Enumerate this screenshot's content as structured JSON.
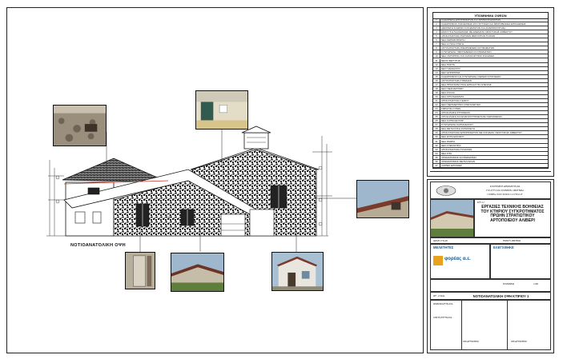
{
  "drawing": {
    "view_label": "ΝΟΤΙΟΑΝΑΤΟΛΙΚΗ ΟΨΗ"
  },
  "legend": {
    "title": "ΥΠΟΜΝΗΜΑ ΟΨΕΩΝ",
    "items": [
      {
        "n": "1",
        "text": "ΚΑΘΑΙΡΕΣΗ ΕΠΙΧΡΙΣΜΑΤΩΝ ΚΑΙ ΑΡΜΟΛΟΓΗΜΑΤΩΝ"
      },
      {
        "n": "2",
        "text": "ΚΑΘΑΡΙΣΜΟΣ ΛΙΘΟΔΟΜΗΣ ΑΠΟ ΦΥΤΙΚΕΣ ΚΑΙ ΜΙΚΡΟΒΙΑΚΕΣ ΕΠΙΚΑΘΙΣΕΙΣ"
      },
      {
        "n": "3",
        "text": "ΑΦΑΙΡΕΣΗ ΣΑΘΡΩΝ ΚΟΝΙΑΜΑΤΩΝ ΚΑΙ ΑΝΑΡΜΟΛΟΓΗΣΗ"
      },
      {
        "n": "4",
        "text": "ΕΝΙΣΧΥΣΗ ΛΙΘΟΔΟΜΗΣ ΜΕ ΕΝΕΜΑΤΑ ΥΔΡΑΥΛΙΚΗΣ ΑΣΒΕΣΤΟΥ"
      },
      {
        "n": "5",
        "text": "ΑΠΟΚΑΤΑΣΤΑΣΗ ΡΩΓΜΩΝ ΦΕΡΟΝΤΩΝ ΤΟΙΧΩΝ"
      },
      {
        "n": "6",
        "text": "ΝΕΑ ΚΕΡΑΜΟΣΚΕΠΗ"
      },
      {
        "n": "7",
        "text": "ΝΕΑ ΞΥΛΙΝΗ ΣΤΕΓΗ"
      },
      {
        "n": "8",
        "text": "ΑΝΤΙΚΑΤΑΣΤΑΣΗ ΦΘΑΡΜΕΝΩΝ ΚΟΥΦΩΜΑΤΩΝ"
      },
      {
        "n": "9",
        "text": "ΣΥΝΤΗΡΗΣΗ ΥΦΙΣΤΑΜΕΝΩΝ ΚΟΥΦΩΜΑΤΩΝ"
      },
      {
        "n": "10",
        "text": "ΝΕΑ ΥΔΡΟΡΡΟΗ ΚΑΙ ΚΑΤΑΚΟΡΥΦΟΙ ΣΩΛΗΝΕΣ"
      },
      {
        "n": "11",
        "text": "ΝΕΟΣ ΦΕΓΓΙΤΗΣ"
      },
      {
        "n": "12",
        "text": "ΝΕΑ ΠΟΡΤΑ"
      },
      {
        "n": "13",
        "text": "ΝΕΟ ΠΑΡΑΘΥΡΟ"
      },
      {
        "n": "14",
        "text": "ΝΕΟ ΕΠΙΧΡΙΣΜΑ"
      },
      {
        "n": "15",
        "text": "ΚΑΘΑΡΙΣΜΟΣ ΚΑΙ ΣΥΝΤΗΡΗΣΗ ΛΙΘΙΝΩΝ ΣΤΟΙΧΕΙΩΝ"
      },
      {
        "n": "16",
        "text": "ΑΝΤΙΚΑΤΑΣΤΑΣΗ ΠΡΕΚΙΩΝ"
      },
      {
        "n": "17",
        "text": "ΝΕΑ ΠΡΟΣΤΑΤΕΥΤΙΚΗ ΕΠΙΚΑΛΥΨΗ ΣΤΕΨΗΣ"
      },
      {
        "n": "18",
        "text": "ΝΕΟ ΠΕΖΟΔΡΟΜΙΟ"
      },
      {
        "n": "19",
        "text": "ΝΕΑ ΣΚΑΛΑ"
      },
      {
        "n": "20",
        "text": "ΝΕΑ ΚΙΓΚΛΙΔΩΜΑΤΑ"
      },
      {
        "n": "21",
        "text": "ΑΠΟΚΑΤΑΣΤΑΣΗ ΓΕΙΣΟΥ"
      },
      {
        "n": "22",
        "text": "ΝΕΟ ΠΕΡΙΜΕΤΡΙΚΟ ΣΤΕΓΑΝΩΤΙΚΟ"
      },
      {
        "n": "23",
        "text": "ΣΦΡΑΓΙΣΗ ΟΠΩΝ"
      },
      {
        "n": "24",
        "text": "ΑΠΟΞΗΛΩΣΗ ΣΤΟΙΧΕΙΩΝ"
      },
      {
        "n": "25",
        "text": "ΑΠΟΞΗΛΩΣΗ ΚΑΙ ΕΠΑΝΑΤΟΠΟΘΕΤΗΣΗ ΚΕΡΑΜΙΔΙΩΝ"
      },
      {
        "n": "26",
        "text": "ΝΕΑ ΚΑΠΝΟΔΟΧΟΣ"
      },
      {
        "n": "27",
        "text": "ΣΥΝΤΗΡΗΣΗ ΚΑΠΝΟΔΟΧΟΥ"
      },
      {
        "n": "28",
        "text": "ΝΕΑ ΜΕΤΑΛΛΙΚΗ ΚΑΤΑΣΚΕΥΗ"
      },
      {
        "n": "29",
        "text": "ΑΠΟΚΑΤΑΣΤΑΣΗ ΕΠΙΧΡΙΣΜΑΤΟΣ ΜΕ ΚΟΝΙΑΜΑ ΥΔΡΑΥΛΙΚΗΣ ΑΣΒΕΣΤΟΥ"
      },
      {
        "n": "30",
        "text": "ΝΕΑ ΘΥΡΑ ΕΙΣΟΔΟΥ"
      },
      {
        "n": "31",
        "text": "ΝΕΑ ΡΑΜΠΑ"
      },
      {
        "n": "32",
        "text": "ΝΕΟ ΣΤΕΓΑΣΤΡΟ"
      },
      {
        "n": "33",
        "text": "ΑΠΟΚΑΤΑΣΤΑΣΗ ΠΛΑΙΣΙΩΝ"
      },
      {
        "n": "34",
        "text": "ΝΕΑ ΣΙΤΑ"
      },
      {
        "n": "35",
        "text": "ΧΡΩΜΑΤΙΣΜΟΣ ΚΟΥΦΩΜΑΤΩΝ"
      },
      {
        "n": "36",
        "text": "ΧΡΩΜΑΤΙΣΜΟΣ ΜΕΤΑΛΛΙΚΩΝ"
      },
      {
        "n": "37",
        "text": "ΛΟΙΠΕΣ ΕΡΓΑΣΙΕΣ"
      }
    ]
  },
  "titleblock": {
    "authority_lines": [
      "ΕΛΛΗΝΙΚΗ ΔΗΜΟΚΡΑΤΙΑ",
      "ΥΠΟΥΡΓΕΙΟ ΕΘΝΙΚΗΣ ΑΜΥΝΑΣ",
      "ΓΕΝΙΚΟ ΕΠΙΤΕΛΕΙΟ ΣΤΡΑΤΟΥ"
    ],
    "project_label": "ΕΡΓΟ",
    "project_title": "ΕΡΓΑΣΙΕΣ ΤΕΧΝΙΚΗΣ ΒΟΗΘΕΙΑΣ ΤΟΥ ΚΤΗΡΙΟΥ ΣΥΓΚΡΟΤΗΜΑΤΟΣ ΠΡΩΗΝ ΣΤΡΑΤΙΩΤΙΚΟΥ ΑΡΤΟΠΟΙΕΙΟΥ ΑΛΙΒΕΡΙ",
    "owner_label": "ΙΔΙΟΚΤΗΣΙΑ",
    "designer_label": "ΜΕΛΕΤΗΤΕΣ",
    "company_name": "φορέας α.ε.",
    "check_label": "ΕΛΕΓΧΘΗΚΕ",
    "date_label": "ΗΜΕΡΟΜΗΝΙΑ",
    "scale_label": "ΚΛΙΜΑΚΑ",
    "scale_value": "1:50",
    "drawing_title": "ΝΟΤΙΟΑΝΑΤΟΛΙΚΗ ΟΨΗ ΚΤΙΡΙΟΥ 1",
    "sheet_label": "ΑΡ. ΣΧΕΔ.",
    "revision_label": "ΑΝΑΘΕΩΡΗΣΕΙΣ",
    "notes_label": "ΠΑΡΑΤΗΡΗΣΕΙΣ",
    "sign_left": "ΘΕΩΡΗΘΗΚΕ",
    "sign_right": "ΘΕΩΡΗΘΗΚΕ"
  },
  "colors": {
    "frame": "#222222",
    "sky": "#9fb7cc",
    "roof": "#7a3b2a",
    "plaster": "#e9e6df",
    "grass": "#5f7d3c"
  }
}
